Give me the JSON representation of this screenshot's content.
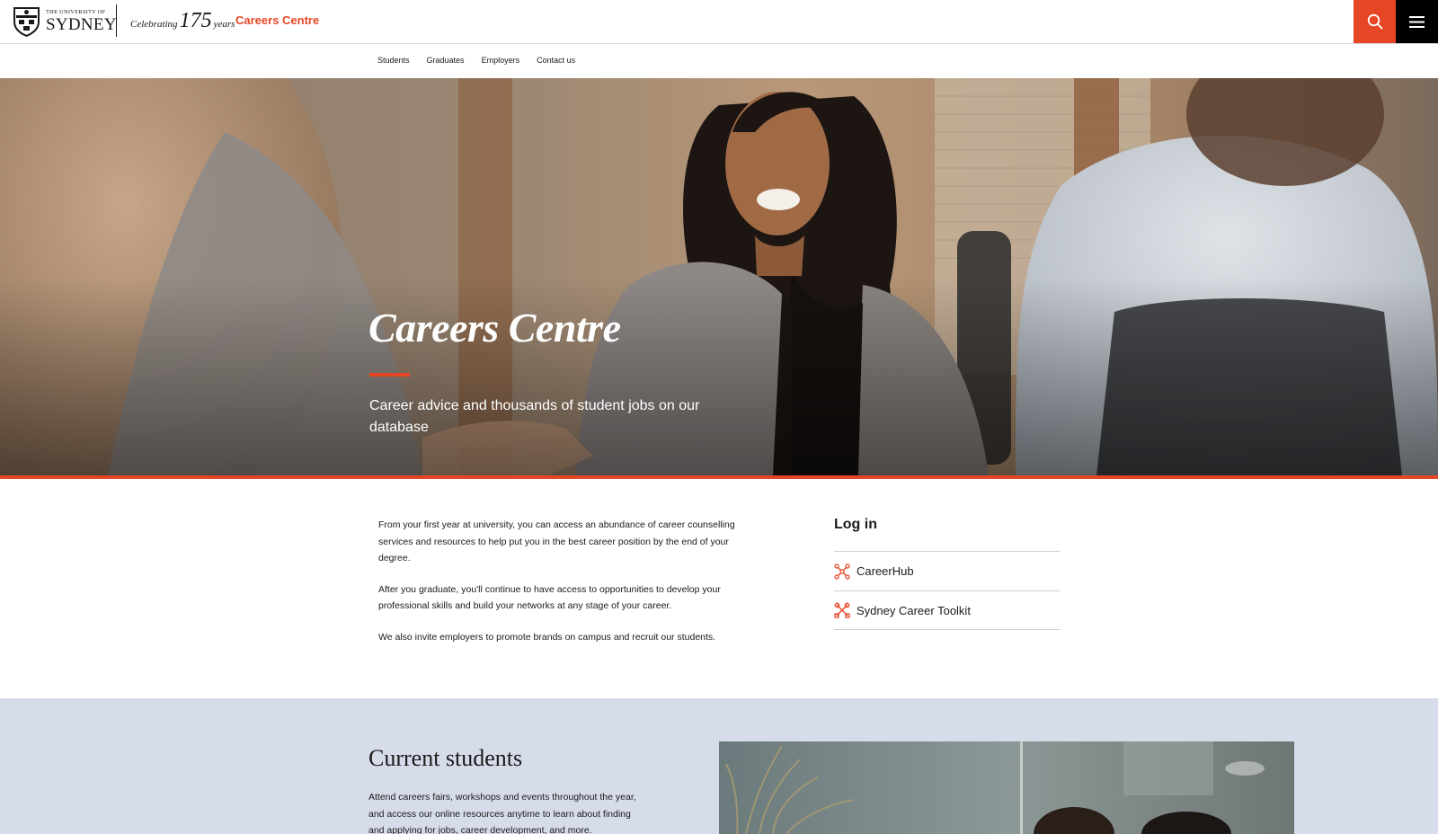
{
  "header": {
    "university_small": "THE UNIVERSITY OF",
    "university_big": "SYDNEY",
    "celebrating": "Celebrating",
    "years_number": "175",
    "years_word": "years",
    "site_name": "Careers Centre",
    "icons": {
      "search": "search-icon",
      "menu": "hamburger-menu-icon"
    },
    "colors": {
      "accent": "#e64626",
      "dark": "#000000"
    }
  },
  "subnav": {
    "items": [
      {
        "label": "Students"
      },
      {
        "label": "Graduates"
      },
      {
        "label": "Employers"
      },
      {
        "label": "Contact us"
      }
    ]
  },
  "hero": {
    "title": "Careers Centre",
    "subtitle": "Career advice and thousands of student jobs on our database"
  },
  "intro": {
    "paragraphs": [
      "From your first year at university, you can access an abundance of career counselling services and resources to help put you in the best career position by the end of your degree.",
      "After you graduate, you'll continue to have access to opportunities to develop your professional skills and build your networks at any stage of your career.",
      "We also invite employers to promote brands on campus and recruit our students."
    ]
  },
  "login": {
    "heading": "Log in",
    "links": [
      {
        "label": "CareerHub",
        "icon": "network-icon"
      },
      {
        "label": "Sydney Career Toolkit",
        "icon": "tools-icon"
      }
    ]
  },
  "students_section": {
    "heading": "Current students",
    "body": "Attend careers fairs, workshops and events throughout the year, and access our online resources anytime to learn about finding and applying for jobs, career development, and more.",
    "background": "#d6dcea"
  }
}
